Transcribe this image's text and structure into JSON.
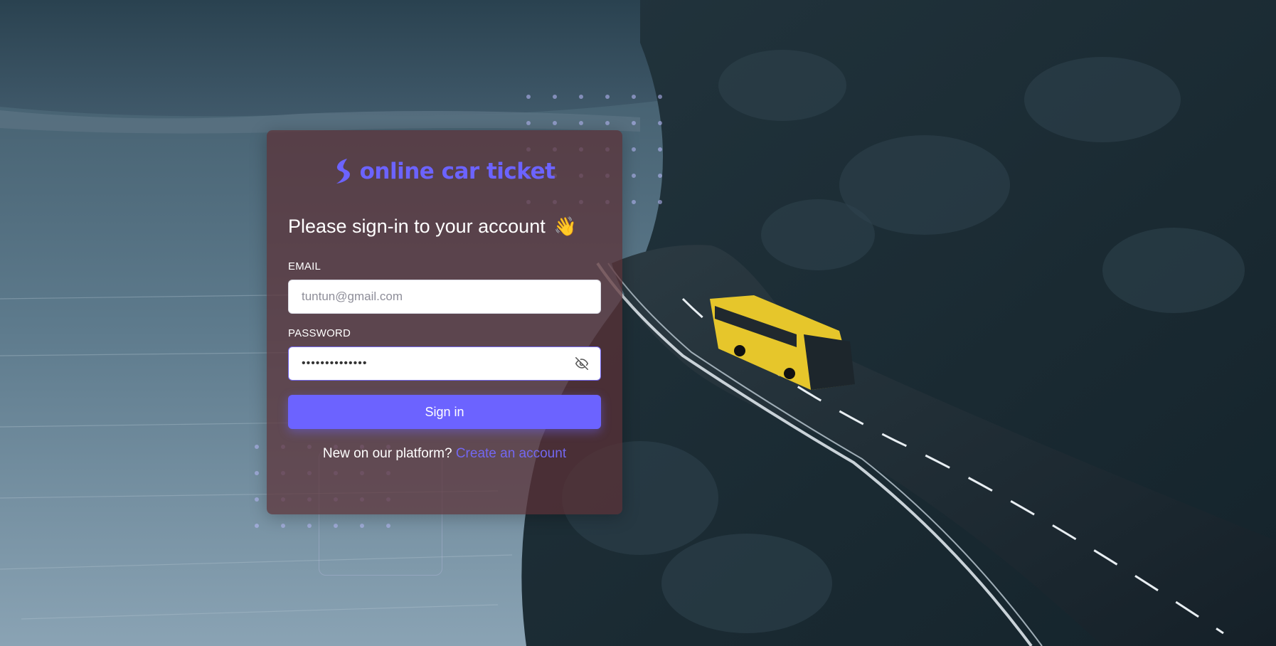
{
  "brand": {
    "name": "online car ticket",
    "color": "#6c63ff"
  },
  "login": {
    "heading": "Please sign-in to your account",
    "heading_emoji": "👋",
    "email_label": "EMAIL",
    "email_placeholder": "tuntun@gmail.com",
    "password_label": "PASSWORD",
    "password_value": "••••••••••••••",
    "submit_label": "Sign in",
    "footer_text": "New on our platform?",
    "create_account_link": "Create an account"
  },
  "icons": {
    "logo": "bolt-logo-icon",
    "password_toggle": "eye-off-icon"
  },
  "colors": {
    "primary": "#6c63ff",
    "card_bg": "#5c3036",
    "input_bg": "#ffffff"
  }
}
